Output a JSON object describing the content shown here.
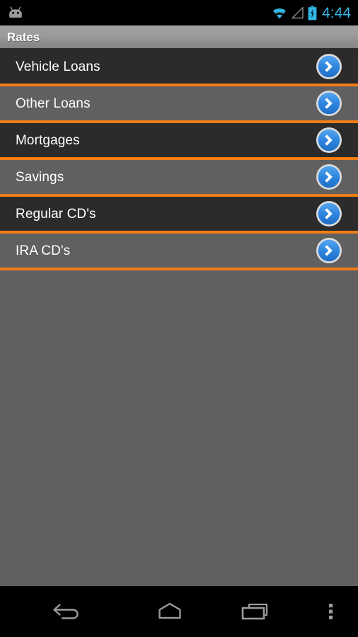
{
  "status_bar": {
    "notification_icon": "android-robot-icon",
    "wifi_icon": "wifi-icon",
    "signal_icon": "cell-signal-icon",
    "battery_icon": "battery-charging-icon",
    "clock": "4:44",
    "accent_color": "#33b5e5"
  },
  "title_bar": {
    "title": "Rates"
  },
  "list": {
    "separator_color": "#f07d16",
    "row_dark_color": "#2b2b2b",
    "row_light_color": "#606060",
    "chevron_icon": "chevron-right-circle-icon",
    "items": [
      {
        "label": "Vehicle Loans"
      },
      {
        "label": "Other Loans"
      },
      {
        "label": "Mortgages"
      },
      {
        "label": "Savings"
      },
      {
        "label": "Regular CD's"
      },
      {
        "label": "IRA CD's"
      }
    ]
  },
  "nav_bar": {
    "back": "back-icon",
    "home": "home-icon",
    "recents": "recent-apps-icon",
    "menu": "overflow-menu-icon",
    "icon_color": "#9a9a9a"
  }
}
